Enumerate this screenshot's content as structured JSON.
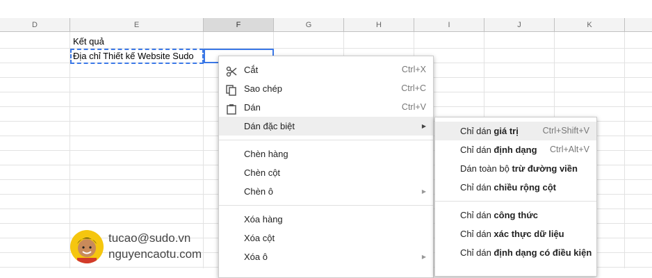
{
  "columns": [
    "D",
    "E",
    "F",
    "G",
    "H",
    "I",
    "J",
    "K"
  ],
  "cells": {
    "e1": "Kết quả",
    "e2": "Địa chỉ Thiết kế Website Sudo"
  },
  "context_menu": {
    "cut": {
      "label": "Cắt",
      "shortcut": "Ctrl+X"
    },
    "copy": {
      "label": "Sao chép",
      "shortcut": "Ctrl+C"
    },
    "paste": {
      "label": "Dán",
      "shortcut": "Ctrl+V"
    },
    "paste_special": {
      "label": "Dán đặc biệt"
    },
    "insert_row": "Chèn hàng",
    "insert_col": "Chèn cột",
    "insert_cell": "Chèn ô",
    "delete_row": "Xóa hàng",
    "delete_col": "Xóa cột",
    "delete_cell": "Xóa ô"
  },
  "submenu": {
    "values": {
      "pre": "Chỉ dán ",
      "bold": "giá trị",
      "shortcut": "Ctrl+Shift+V"
    },
    "format": {
      "pre": "Chỉ dán ",
      "bold": "định dạng",
      "shortcut": "Ctrl+Alt+V"
    },
    "no_borders": {
      "pre": "Dán toàn bộ ",
      "bold": "trừ đường viền"
    },
    "col_width": {
      "pre": "Chỉ dán ",
      "bold": "chiều rộng cột"
    },
    "formula": {
      "pre": "Chỉ dán ",
      "bold": "công thức"
    },
    "validation": {
      "pre": "Chỉ dán ",
      "bold": "xác thực dữ liệu"
    },
    "cond_format": {
      "pre": "Chỉ dán ",
      "bold": "định dạng có điều kiện"
    }
  },
  "watermark": {
    "email": "tucao@sudo.vn",
    "site": "nguyencaotu.com"
  },
  "colors": {
    "accent": "#3b78e7",
    "menu_highlight": "#eeeeee"
  }
}
